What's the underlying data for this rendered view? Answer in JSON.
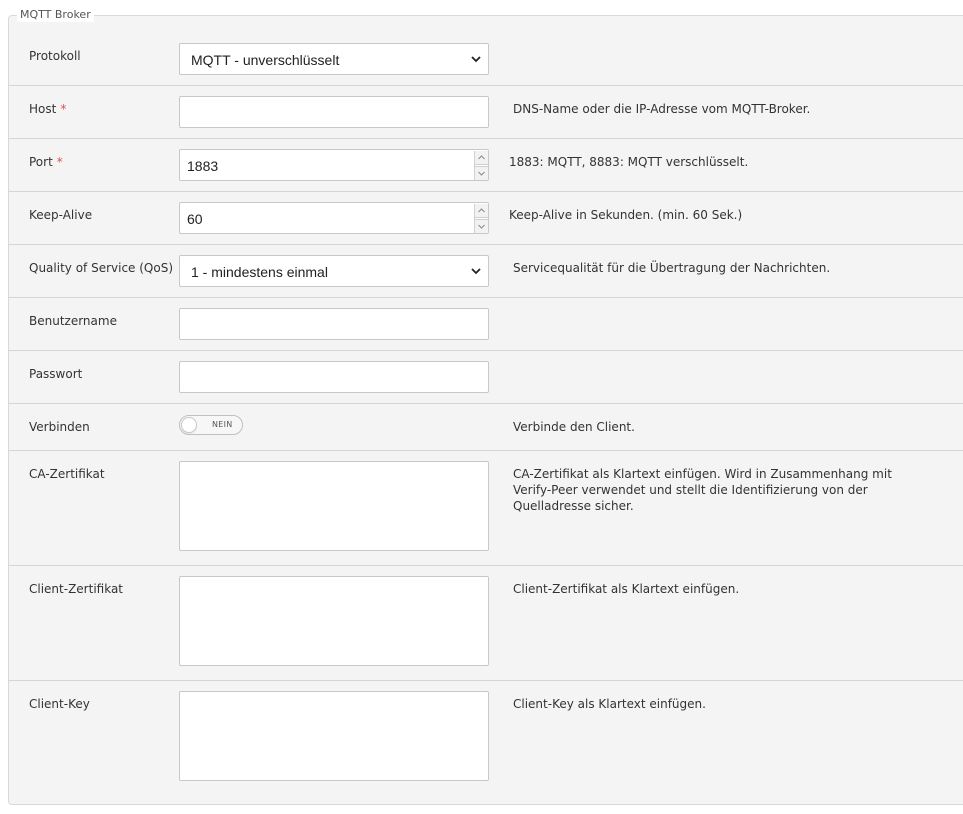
{
  "fieldset": {
    "legend": "MQTT Broker"
  },
  "rows": {
    "protocol": {
      "label": "Protokoll",
      "value": "MQTT - unverschlüsselt"
    },
    "host": {
      "label": "Host",
      "required": "*",
      "value": "",
      "help": "DNS-Name oder die IP-Adresse vom MQTT-Broker."
    },
    "port": {
      "label": "Port",
      "required": "*",
      "value": "1883",
      "help": "1883: MQTT, 8883: MQTT verschlüsselt."
    },
    "keepalive": {
      "label": "Keep-Alive",
      "value": "60",
      "help": "Keep-Alive in Sekunden. (min. 60 Sek.)"
    },
    "qos": {
      "label": "Quality of Service (QoS)",
      "value": "1 - mindestens einmal",
      "help": "Servicequalität für die Übertragung der Nachrichten."
    },
    "username": {
      "label": "Benutzername",
      "value": ""
    },
    "password": {
      "label": "Passwort",
      "value": ""
    },
    "connect": {
      "label": "Verbinden",
      "toggle_text": "NEIN",
      "help": "Verbinde den Client."
    },
    "ca_cert": {
      "label": "CA-Zertifikat",
      "value": "",
      "help": "CA-Zertifikat als Klartext einfügen. Wird in Zusammenhang mit Verify-Peer verwendet und stellt die Identifizierung von der Quelladresse sicher."
    },
    "client_cert": {
      "label": "Client-Zertifikat",
      "value": "",
      "help": "Client-Zertifikat als Klartext einfügen."
    },
    "client_key": {
      "label": "Client-Key",
      "value": "",
      "help": "Client-Key als Klartext einfügen."
    }
  },
  "icons": {
    "select_arrow": "chevron-down-icon",
    "spin_up": "chevron-up-icon",
    "spin_down": "chevron-down-icon"
  },
  "colors": {
    "required": "#e05050",
    "panel_bg": "#f4f4f4",
    "border": "#c8c8c8"
  }
}
